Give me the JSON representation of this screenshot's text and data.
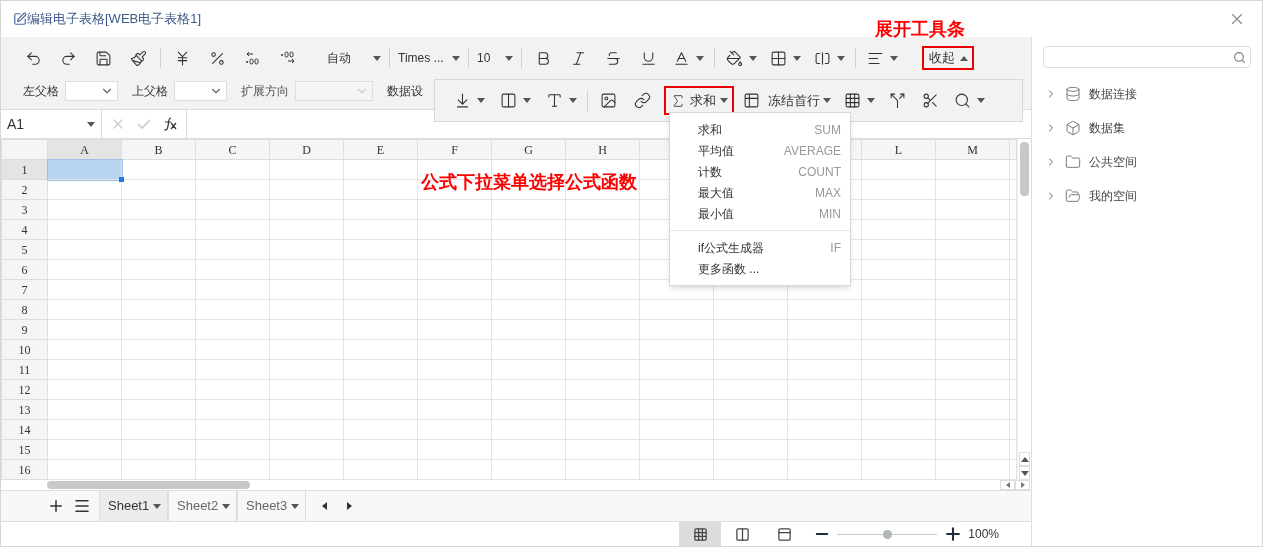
{
  "window": {
    "title": "编辑电子表格[WEB电子表格1]"
  },
  "annotations": [
    {
      "kind": "toolbar",
      "text": "展开工具条"
    },
    {
      "kind": "menu",
      "text": "公式下拉菜单选择公式函数"
    }
  ],
  "toolbar": {
    "number_format": "自动",
    "font_family": "Times ...",
    "font_size": "10",
    "collapse_button": "收起"
  },
  "cell_settings": [
    {
      "label": "左父格",
      "disabled": false
    },
    {
      "label": "上父格",
      "disabled": false
    },
    {
      "label": "扩展方向",
      "disabled": true
    }
  ],
  "data_settings_label": "数据设",
  "floating_toolbar": {
    "formula_button": "求和",
    "freeze_button": "冻结首行"
  },
  "formula_menu": {
    "groups": [
      [
        {
          "label": "求和",
          "code": "SUM"
        },
        {
          "label": "平均值",
          "code": "AVERAGE"
        },
        {
          "label": "计数",
          "code": "COUNT"
        },
        {
          "label": "最大值",
          "code": "MAX"
        },
        {
          "label": "最小值",
          "code": "MIN"
        }
      ],
      [
        {
          "label": "if公式生成器",
          "code": "IF"
        },
        {
          "label": "更多函数 ..."
        }
      ]
    ]
  },
  "formula_bar": {
    "cell_ref": "A1"
  },
  "grid": {
    "columns": [
      {
        "label": "A",
        "selected": true
      },
      {
        "label": "B",
        "selected": false
      },
      {
        "label": "C",
        "selected": false
      },
      {
        "label": "D",
        "selected": false
      },
      {
        "label": "E",
        "selected": false
      },
      {
        "label": "F",
        "selected": false
      },
      {
        "label": "G",
        "selected": false
      },
      {
        "label": "H",
        "selected": false
      },
      {},
      {},
      {},
      {
        "label": "L",
        "selected": false
      },
      {
        "label": "M",
        "selected": false
      }
    ],
    "rows": [
      {
        "label": "1",
        "selected": true
      },
      {
        "label": "2",
        "selected": false
      },
      {
        "label": "3",
        "selected": false
      },
      {
        "label": "4",
        "selected": false
      },
      {
        "label": "5",
        "selected": false
      },
      {
        "label": "6",
        "selected": false
      },
      {
        "label": "7",
        "selected": false
      },
      {
        "label": "8",
        "selected": false
      },
      {
        "label": "9",
        "selected": false
      },
      {
        "label": "10",
        "selected": false
      },
      {
        "label": "11",
        "selected": false
      },
      {
        "label": "12",
        "selected": false
      },
      {
        "label": "13",
        "selected": false
      },
      {
        "label": "14",
        "selected": false
      },
      {
        "label": "15",
        "selected": false
      },
      {
        "label": "16",
        "selected": false
      }
    ]
  },
  "sheets": [
    {
      "label": "Sheet1",
      "selected": true
    },
    {
      "label": "Sheet2",
      "selected": false
    },
    {
      "label": "Sheet3",
      "selected": false
    }
  ],
  "status_bar": {
    "views": [
      {
        "kind": "normal",
        "selected": true
      },
      {
        "kind": "page_break",
        "selected": false
      },
      {
        "kind": "page_layout",
        "selected": false
      }
    ],
    "zoom": {
      "level": 0.5,
      "reading": "100%"
    }
  },
  "side_panel": {
    "tree": [
      {
        "kind": "connection",
        "label": "数据连接",
        "expanded": false
      },
      {
        "kind": "dataset",
        "label": "数据集",
        "expanded": false
      },
      {
        "kind": "folder",
        "label": "公共空间",
        "expanded": false
      },
      {
        "kind": "user_folder",
        "label": "我的空间",
        "expanded": false
      }
    ]
  }
}
